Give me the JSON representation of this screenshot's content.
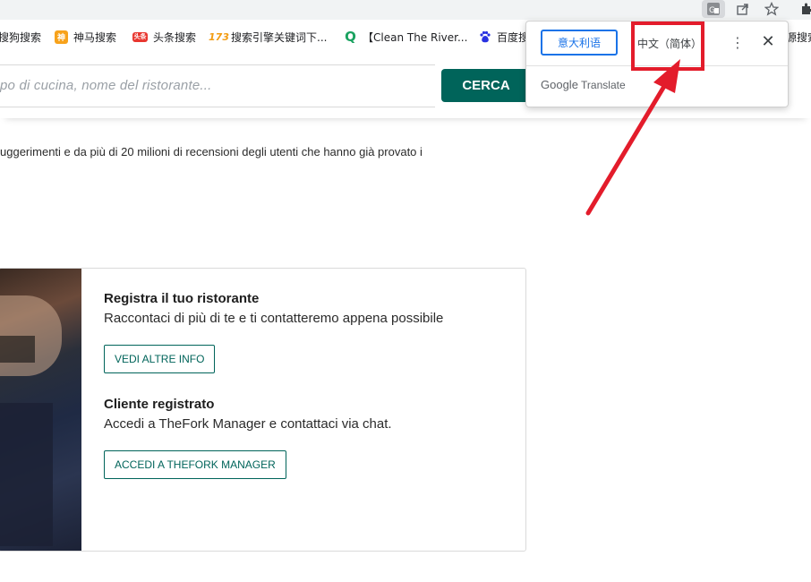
{
  "browser": {
    "toolbar_icons": [
      "translate-icon",
      "share-icon",
      "bookmark-star-icon",
      "extensions-icon"
    ],
    "bookmarks": [
      {
        "label": "搜狗搜索",
        "icon": "sogou-icon",
        "color": "#ffffff"
      },
      {
        "label": "神马搜索",
        "icon": "shenma-icon",
        "color": "#f7a21b",
        "glyph": "神"
      },
      {
        "label": "头条搜索",
        "icon": "toutiao-icon",
        "color": "#e8362f",
        "glyph": "头条"
      },
      {
        "label": "搜索引擎关键词下...",
        "icon": "keyword-icon",
        "color": "#f39c12",
        "glyph": "173"
      },
      {
        "label": "【Clean The River...",
        "icon": "q-icon",
        "color": "#1aa260",
        "glyph": "Q"
      },
      {
        "label": "百度搜",
        "icon": "baidu-icon",
        "color": "#2932e1"
      },
      {
        "label": "源搜索",
        "icon": "source-icon",
        "color": "#ffffff"
      }
    ]
  },
  "search": {
    "placeholder": "po di cucina, nome del ristorante...",
    "button_label": "CERCA"
  },
  "intro_text": "uggerimenti e da più di 20 milioni di recensioni degli utenti che hanno già provato i",
  "card": {
    "section1": {
      "title": "Registra il tuo ristorante",
      "desc": "Raccontaci di più di te e ti contatteremo appena possibile",
      "button": "VEDI ALTRE INFO"
    },
    "section2": {
      "title": "Cliente registrato",
      "desc": "Accedi a TheFork Manager e contattaci via chat.",
      "button": "ACCEDI A THEFORK MANAGER"
    }
  },
  "translate_popup": {
    "source_lang": "意大利语",
    "target_lang": "中文（简体）",
    "brand_google": "Google",
    "brand_translate": "Translate"
  },
  "annotation": {
    "color": "#e31c2b"
  }
}
